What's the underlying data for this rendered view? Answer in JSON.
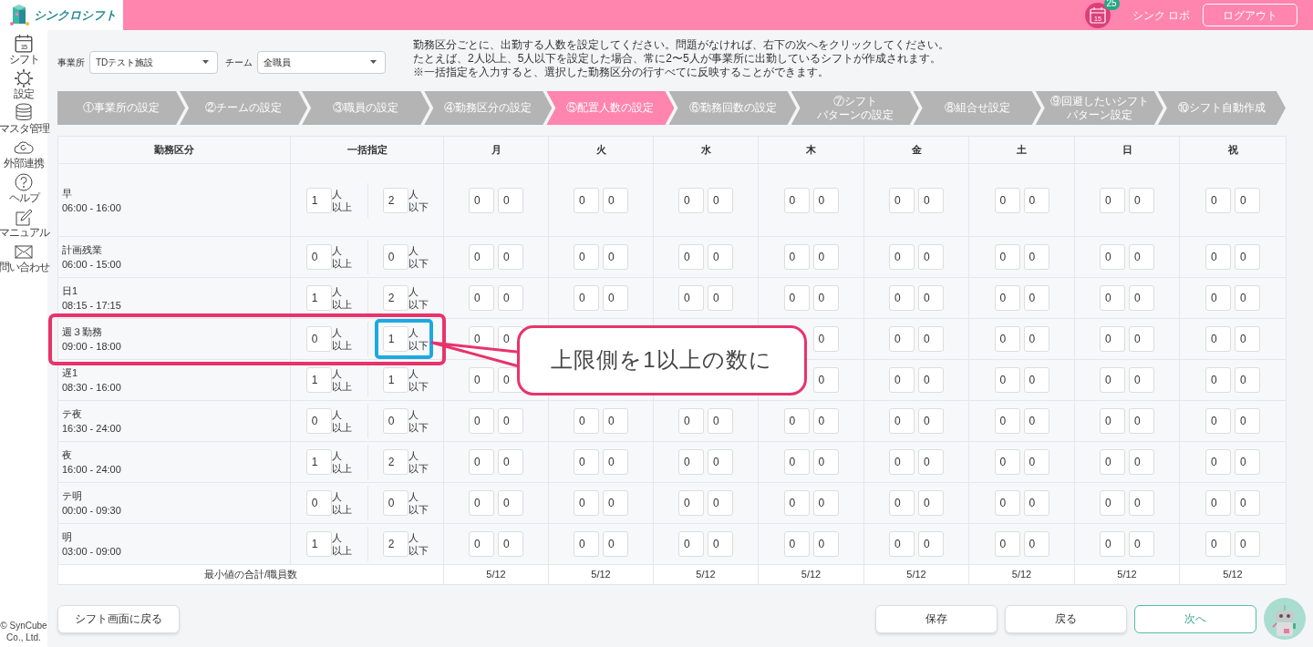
{
  "header": {
    "logo_text": "シンクロシフト",
    "calendar_icon_text": "15",
    "notification_count": "25",
    "user_name": "シンク ロボ",
    "logout_button": "ログアウト"
  },
  "sidebar": {
    "items": [
      {
        "label": "シフト",
        "icon_text": "15"
      },
      {
        "label": "設定"
      },
      {
        "label": "マスタ管理"
      },
      {
        "label": "外部連携"
      },
      {
        "label": "ヘルプ"
      },
      {
        "label": "マニュアル"
      },
      {
        "label": "問い合わせ"
      }
    ],
    "copyright": "© SynCube Co., Ltd."
  },
  "filters": [
    {
      "label": "事業所",
      "value": "TDテスト施設"
    },
    {
      "label": "チーム",
      "value": "全職員"
    }
  ],
  "instructions": [
    "勤務区分ごとに、出勤する人数を設定してください。問題がなければ、右下の次へをクリックしてください。",
    "たとえば、2人以上、5人以下を設定した場合、常に2〜5人が事業所に出勤しているシフトが作成されます。",
    "※一括指定を入力すると、選択した勤務区分の行すべてに反映することができます。"
  ],
  "steps": [
    {
      "lines": [
        "①事業所の設定"
      ],
      "selected": false
    },
    {
      "lines": [
        "②チームの設定"
      ],
      "selected": false
    },
    {
      "lines": [
        "③職員の設定"
      ],
      "selected": false
    },
    {
      "lines": [
        "④勤務区分の設定"
      ],
      "selected": false
    },
    {
      "lines": [
        "⑤配置人数の設定"
      ],
      "selected": true
    },
    {
      "lines": [
        "⑥勤務回数の設定"
      ],
      "selected": false
    },
    {
      "lines": [
        "⑦シフト",
        "パターンの設定"
      ],
      "selected": false
    },
    {
      "lines": [
        "⑧組合せ設定"
      ],
      "selected": false
    },
    {
      "lines": [
        "⑨回避したいシフト",
        "パターン設定"
      ],
      "selected": false
    },
    {
      "lines": [
        "⑩シフト自動作成"
      ],
      "selected": false
    }
  ],
  "table": {
    "columns": [
      "勤務区分",
      "一括指定",
      "月",
      "火",
      "水",
      "木",
      "金",
      "土",
      "日",
      "祝"
    ],
    "rows": [
      {
        "name": "早",
        "time": "06:00 - 16:00",
        "bulk_min": "1",
        "min_label": "人以上",
        "bulk_max": "2",
        "max_label": "人以下",
        "highlighted": false,
        "days": [
          {
            "min": "0",
            "max": "0"
          },
          {
            "min": "0",
            "max": "0"
          },
          {
            "min": "0",
            "max": "0"
          },
          {
            "min": "0",
            "max": "0"
          },
          {
            "min": "0",
            "max": "0"
          },
          {
            "min": "0",
            "max": "0"
          },
          {
            "min": "0",
            "max": "0"
          },
          {
            "min": "0",
            "max": "0"
          }
        ]
      },
      {
        "name": "計画残業",
        "time": "06:00 - 15:00",
        "bulk_min": "0",
        "min_label": "人以上",
        "bulk_max": "0",
        "max_label": "人以下",
        "highlighted": false,
        "days": [
          {
            "min": "0",
            "max": "0"
          },
          {
            "min": "0",
            "max": "0"
          },
          {
            "min": "0",
            "max": "0"
          },
          {
            "min": "0",
            "max": "0"
          },
          {
            "min": "0",
            "max": "0"
          },
          {
            "min": "0",
            "max": "0"
          },
          {
            "min": "0",
            "max": "0"
          },
          {
            "min": "0",
            "max": "0"
          }
        ]
      },
      {
        "name": "日1",
        "time": "08:15 - 17:15",
        "bulk_min": "1",
        "min_label": "人以上",
        "bulk_max": "2",
        "max_label": "人以下",
        "highlighted": false,
        "days": [
          {
            "min": "0",
            "max": "0"
          },
          {
            "min": "0",
            "max": "0"
          },
          {
            "min": "0",
            "max": "0"
          },
          {
            "min": "0",
            "max": "0"
          },
          {
            "min": "0",
            "max": "0"
          },
          {
            "min": "0",
            "max": "0"
          },
          {
            "min": "0",
            "max": "0"
          },
          {
            "min": "0",
            "max": "0"
          }
        ]
      },
      {
        "name": "週３勤務",
        "time": "09:00 - 18:00",
        "bulk_min": "0",
        "min_label": "人以上",
        "bulk_max": "1",
        "max_label": "人以下",
        "highlighted": true,
        "days": [
          {
            "min": "0",
            "max": "0",
            "covered": false
          },
          {
            "covered": true
          },
          {
            "covered": true
          },
          {
            "max": "0",
            "covered": false
          },
          {
            "min": "0",
            "max": "0",
            "covered": false
          },
          {
            "min": "0",
            "max": "0",
            "covered": false
          },
          {
            "min": "0",
            "max": "0",
            "covered": false
          },
          {
            "min": "0",
            "max": "0",
            "covered": false
          }
        ]
      },
      {
        "name": "遅1",
        "time": "08:30 - 16:00",
        "bulk_min": "1",
        "min_label": "人以上",
        "bulk_max": "1",
        "max_label": "人以下",
        "highlighted": false,
        "days": [
          {
            "min": "0",
            "max": "0",
            "covered": false
          },
          {
            "covered": true
          },
          {
            "covered": true
          },
          {
            "max": "0",
            "covered": false
          },
          {
            "min": "0",
            "max": "0",
            "covered": false
          },
          {
            "min": "0",
            "max": "0",
            "covered": false
          },
          {
            "min": "0",
            "max": "0",
            "covered": false
          },
          {
            "min": "0",
            "max": "0",
            "covered": false
          }
        ]
      },
      {
        "name": "テ夜",
        "time": "16:30 - 24:00",
        "bulk_min": "0",
        "min_label": "人以上",
        "bulk_max": "0",
        "max_label": "人以下",
        "highlighted": false,
        "days": [
          {
            "min": "0",
            "max": "0"
          },
          {
            "min": "0",
            "max": "0"
          },
          {
            "min": "0",
            "max": "0"
          },
          {
            "min": "0",
            "max": "0"
          },
          {
            "min": "0",
            "max": "0"
          },
          {
            "min": "0",
            "max": "0"
          },
          {
            "min": "0",
            "max": "0"
          },
          {
            "min": "0",
            "max": "0"
          }
        ]
      },
      {
        "name": "夜",
        "time": "16:00 - 24:00",
        "bulk_min": "1",
        "min_label": "人以上",
        "bulk_max": "2",
        "max_label": "人以下",
        "highlighted": false,
        "days": [
          {
            "min": "0",
            "max": "0"
          },
          {
            "min": "0",
            "max": "0"
          },
          {
            "min": "0",
            "max": "0"
          },
          {
            "min": "0",
            "max": "0"
          },
          {
            "min": "0",
            "max": "0"
          },
          {
            "min": "0",
            "max": "0"
          },
          {
            "min": "0",
            "max": "0"
          },
          {
            "min": "0",
            "max": "0"
          }
        ]
      },
      {
        "name": "テ明",
        "time": "00:00 - 09:30",
        "bulk_min": "0",
        "min_label": "人以上",
        "bulk_max": "0",
        "max_label": "人以下",
        "highlighted": false,
        "days": [
          {
            "min": "0",
            "max": "0"
          },
          {
            "min": "0",
            "max": "0"
          },
          {
            "min": "0",
            "max": "0"
          },
          {
            "min": "0",
            "max": "0"
          },
          {
            "min": "0",
            "max": "0"
          },
          {
            "min": "0",
            "max": "0"
          },
          {
            "min": "0",
            "max": "0"
          },
          {
            "min": "0",
            "max": "0"
          }
        ]
      },
      {
        "name": "明",
        "time": "03:00 - 09:00",
        "bulk_min": "1",
        "min_label": "人以上",
        "bulk_max": "2",
        "max_label": "人以下",
        "highlighted": false,
        "days": [
          {
            "min": "0",
            "max": "0"
          },
          {
            "min": "0",
            "max": "0"
          },
          {
            "min": "0",
            "max": "0"
          },
          {
            "min": "0",
            "max": "0"
          },
          {
            "min": "0",
            "max": "0"
          },
          {
            "min": "0",
            "max": "0"
          },
          {
            "min": "0",
            "max": "0"
          },
          {
            "min": "0",
            "max": "0"
          }
        ]
      }
    ],
    "summary": {
      "label": "最小値の合計/職員数",
      "values": [
        "5/12",
        "5/12",
        "5/12",
        "5/12",
        "5/12",
        "5/12",
        "5/12",
        "5/12"
      ]
    }
  },
  "buttons": {
    "back_to_shift": "シフト画面に戻る",
    "save": "保存",
    "back": "戻る",
    "next": "次へ"
  },
  "annotation": {
    "text": "上限側を1以上の数に"
  }
}
